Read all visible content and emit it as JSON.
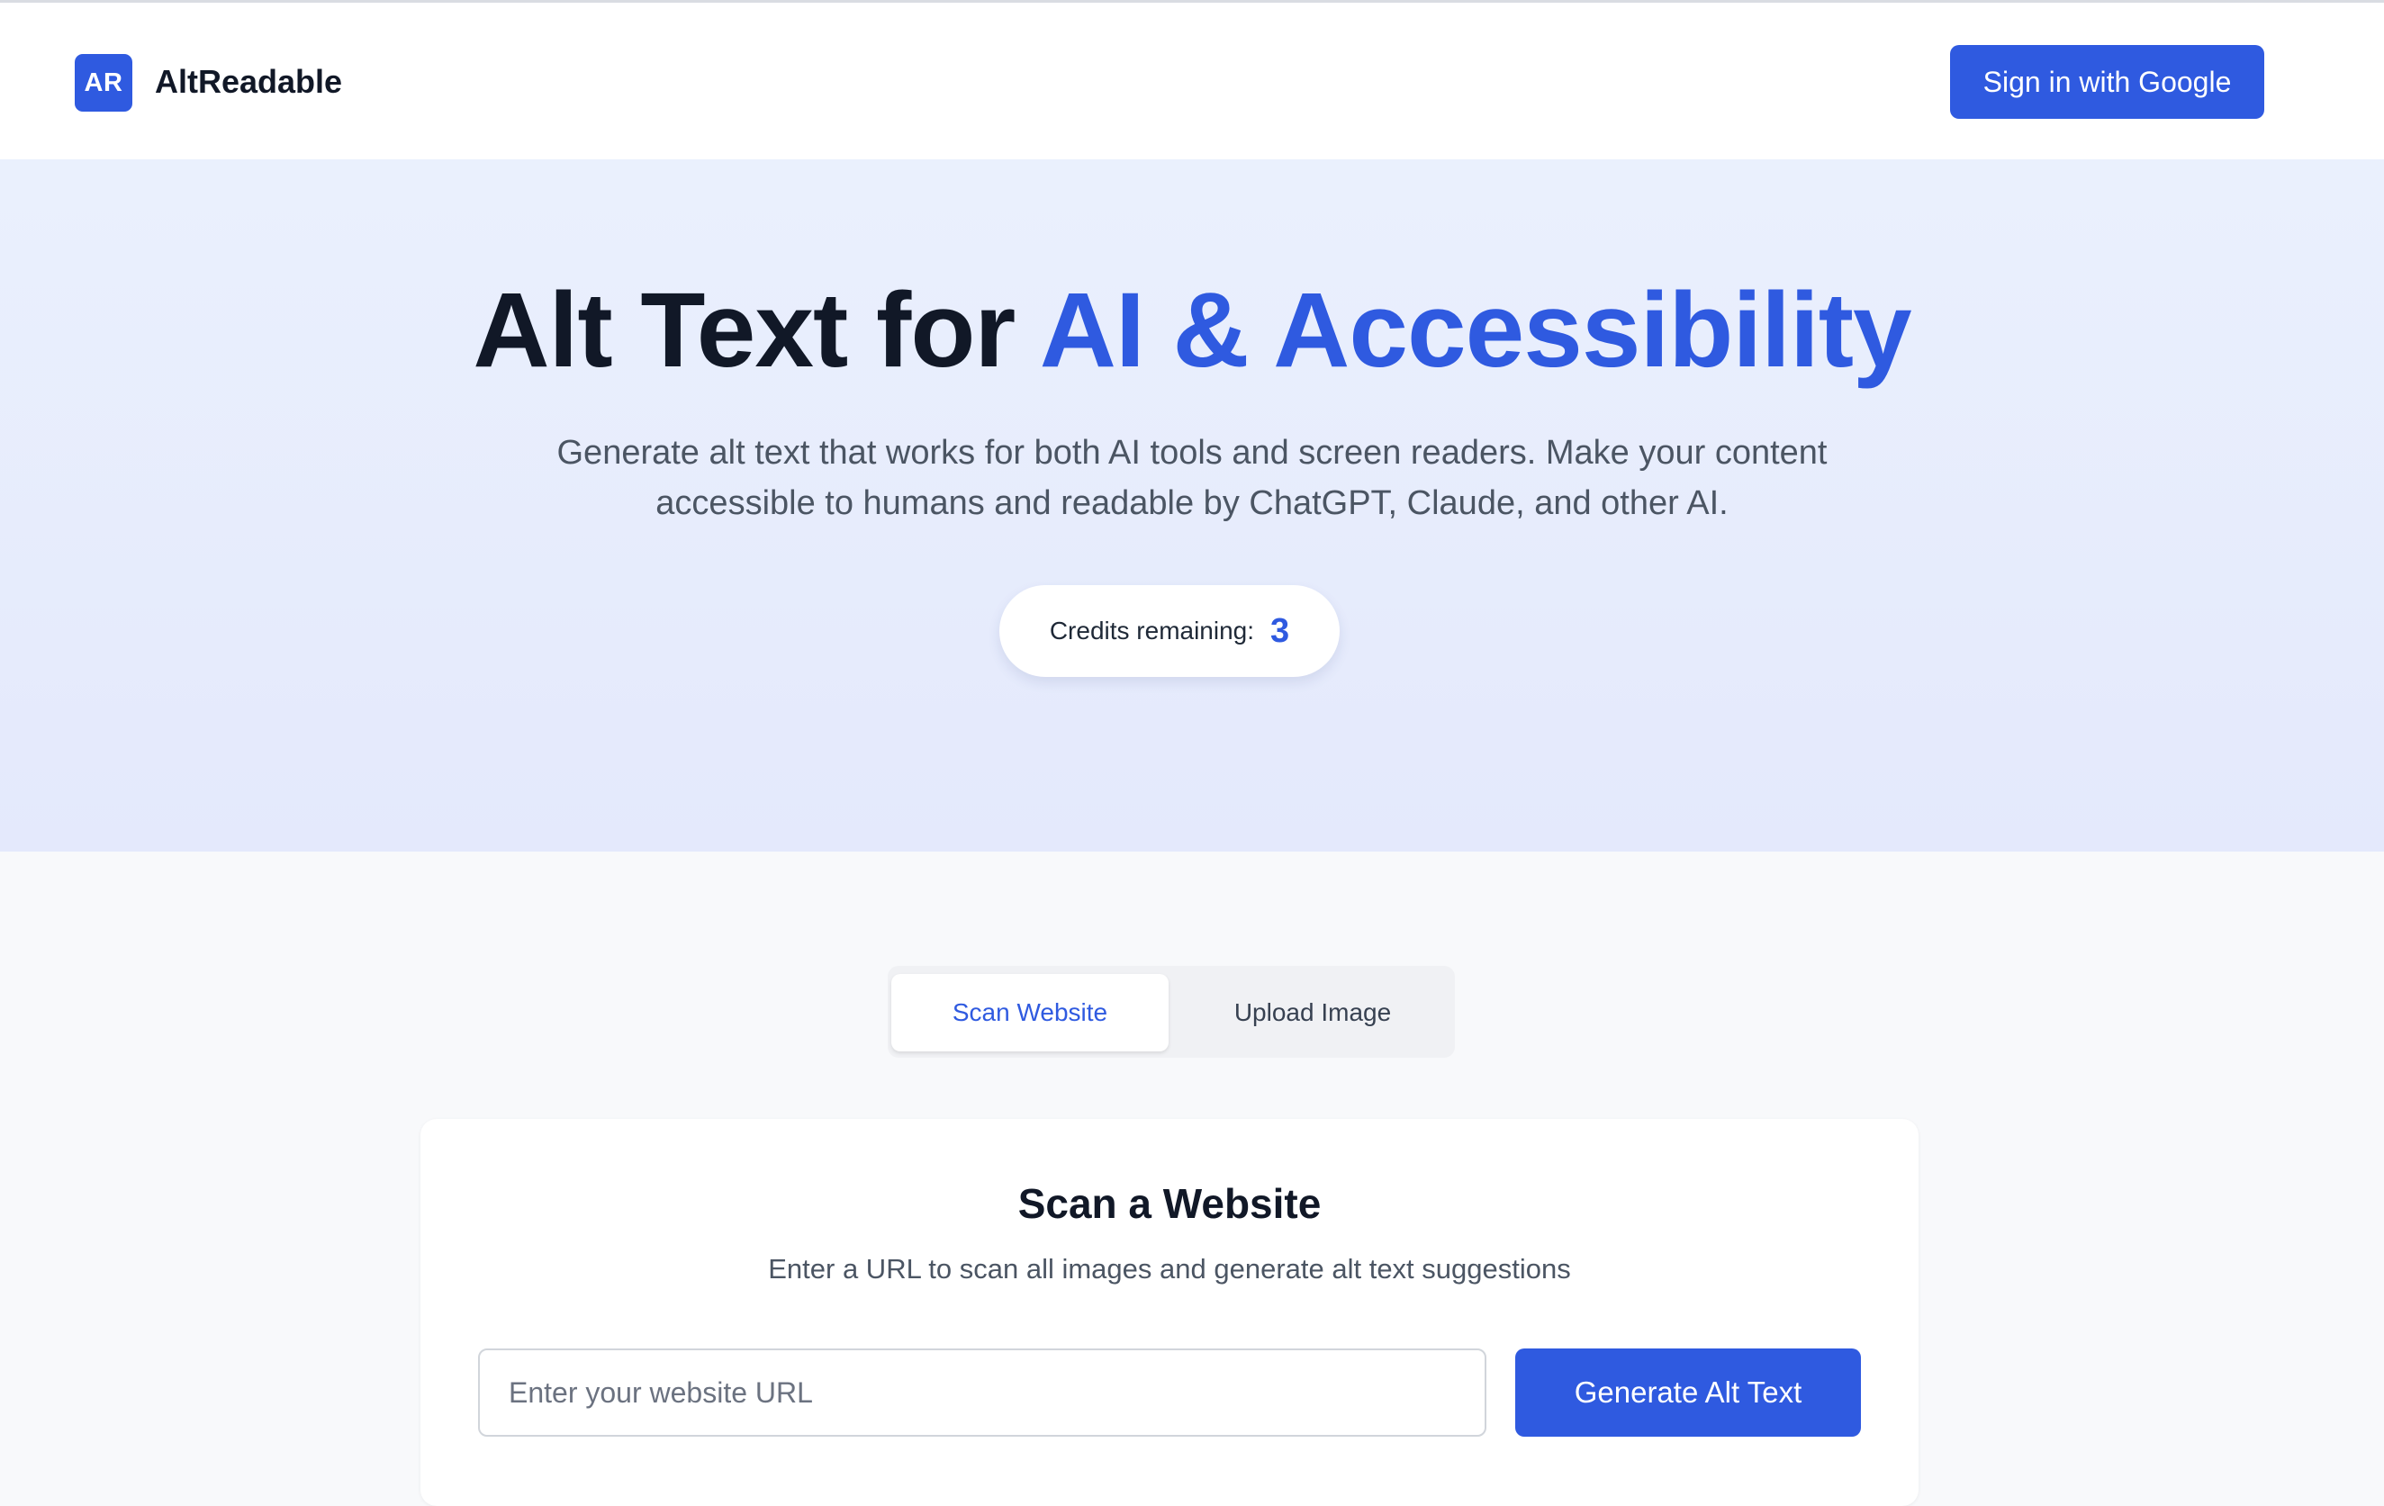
{
  "header": {
    "logo_initials": "AR",
    "brand_name": "AltReadable",
    "signin_label": "Sign in with Google"
  },
  "hero": {
    "title_plain": "Alt Text for ",
    "title_accent": "AI & Accessibility",
    "subtitle_line1": "Generate alt text that works for both AI tools and screen readers. Make your content",
    "subtitle_line2": "accessible to humans and readable by ChatGPT, Claude, and other AI.",
    "credits_label": "Credits remaining:",
    "credits_value": "3"
  },
  "tabs": [
    {
      "label": "Scan Website",
      "active": true
    },
    {
      "label": "Upload Image",
      "active": false
    }
  ],
  "scan_card": {
    "title": "Scan a Website",
    "subtitle": "Enter a URL to scan all images and generate alt text suggestions",
    "url_input_value": "",
    "url_input_placeholder": "Enter your website URL",
    "generate_label": "Generate Alt Text"
  },
  "colors": {
    "accent": "#2f5ae0",
    "text_dark": "#111827",
    "text_muted": "#4b5563",
    "hero_bg": "#e7edfc",
    "page_bg": "#f8f9fb"
  }
}
